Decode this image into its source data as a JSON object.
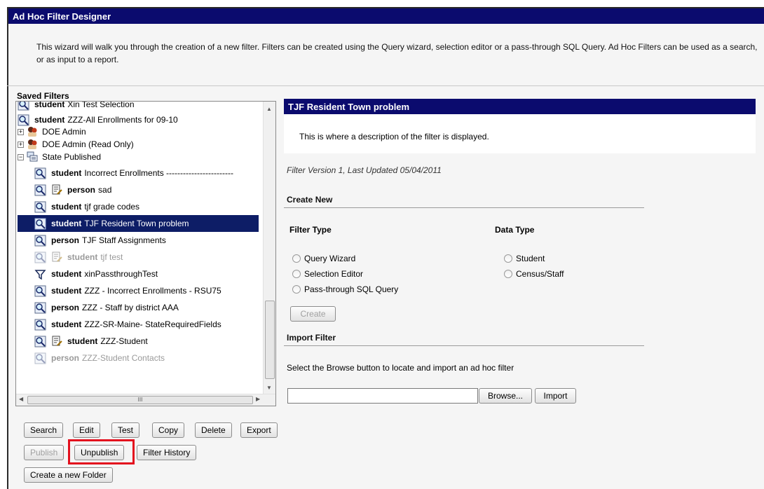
{
  "header": {
    "title": "Ad Hoc Filter Designer"
  },
  "intro": "This wizard will walk you through the creation of a new filter. Filters can be created using the Query wizard, selection editor or a pass-through SQL Query. Ad Hoc Filters can be used as a search, or as input to a report.",
  "saved_filters": {
    "title": "Saved Filters",
    "items": [
      {
        "type": "student",
        "name": "Xin Test Selection"
      },
      {
        "type": "student",
        "name": "ZZZ-All Enrollments for 09-10"
      },
      {
        "folder": "DOE Admin"
      },
      {
        "folder": "DOE Admin (Read Only)"
      },
      {
        "folder": "State Published"
      },
      {
        "type": "student",
        "name": "Incorrect Enrollments ------------------------"
      },
      {
        "type": "person",
        "name": "sad"
      },
      {
        "type": "student",
        "name": "tjf grade codes"
      },
      {
        "type": "student",
        "name": "TJF Resident Town problem"
      },
      {
        "type": "person",
        "name": "TJF Staff Assignments"
      },
      {
        "type": "student",
        "name": "tjf test"
      },
      {
        "type": "student",
        "name": "xinPassthroughTest"
      },
      {
        "type": "student",
        "name": "ZZZ - Incorrect Enrollments - RSU75"
      },
      {
        "type": "person",
        "name": "ZZZ - Staff by district AAA"
      },
      {
        "type": "student",
        "name": "ZZZ-SR-Maine- StateRequiredFields"
      },
      {
        "type": "student",
        "name": "ZZZ-Student"
      },
      {
        "type": "person",
        "name": "ZZZ-Student Contacts"
      }
    ],
    "hscroll_grip": "III"
  },
  "buttons": {
    "search": "Search",
    "edit": "Edit",
    "test": "Test",
    "copy": "Copy",
    "delete": "Delete",
    "export": "Export",
    "publish": "Publish",
    "unpublish": "Unpublish",
    "filter_history": "Filter History",
    "create_folder": "Create a new Folder",
    "create": "Create",
    "browse": "Browse...",
    "import": "Import"
  },
  "filter_panel": {
    "title": "TJF Resident Town problem",
    "description": "This is where a description of the filter is displayed.",
    "version": "Filter Version 1,   Last Updated 05/04/2011"
  },
  "create_new": {
    "title": "Create New",
    "filter_type_label": "Filter Type",
    "data_type_label": "Data Type",
    "filter_types": [
      "Query Wizard",
      "Selection Editor",
      "Pass-through SQL Query"
    ],
    "data_types": [
      "Student",
      "Census/Staff"
    ]
  },
  "import_filter": {
    "title": "Import Filter",
    "instructions": "Select the Browse button to locate and import an ad hoc filter"
  },
  "colors": {
    "header_bg": "#0b0b6e",
    "selected_row": "#0d1d66",
    "highlight_box": "#e3101e"
  }
}
